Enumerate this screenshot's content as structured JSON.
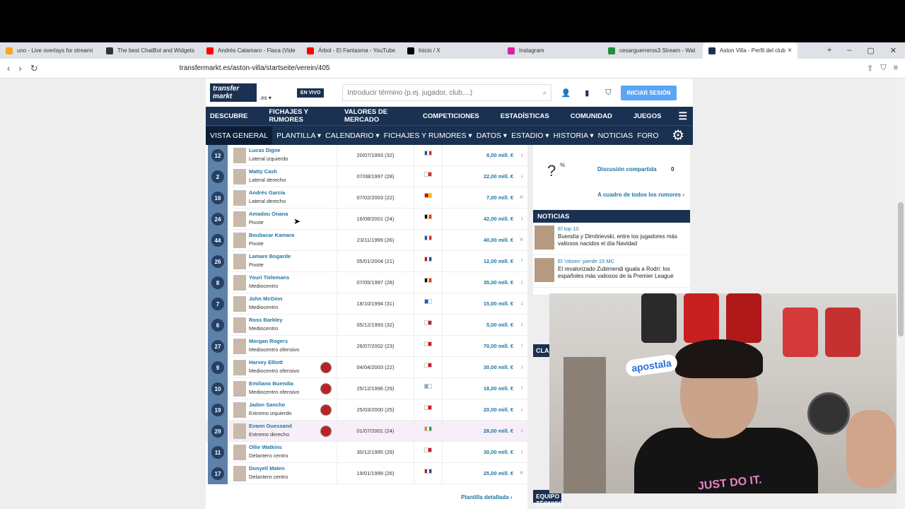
{
  "browser": {
    "tabs": [
      {
        "label": "uno - Live overlays for streami",
        "color": "#f5a623"
      },
      {
        "label": "The best ChatBot and Widgets",
        "color": "#333333"
      },
      {
        "label": "Andrés Calamaro - Flaca (Vide",
        "color": "#ff0000"
      },
      {
        "label": "Árbol - El Fantasma - YouTube",
        "color": "#ff0000"
      },
      {
        "label": "Inicio / X",
        "color": "#000000"
      },
      {
        "label": "Instagram",
        "color": "#d6249f"
      },
      {
        "label": "cesarguerreros3 Stream - Wat",
        "color": "#1f8f3a"
      },
      {
        "label": "Aston Villa - Perfil del club",
        "color": "#1a3151"
      }
    ],
    "url": "transfermarkt.es/aston-villa/startseite/verein/405"
  },
  "header": {
    "logo_line1": "transfer",
    "logo_line2": "markt",
    "tld": ".es ▾",
    "live": "EN VIVO",
    "search_placeholder": "Introducir término (p.ej. jugador, club,...)",
    "login": "INICIAR SESIÓN"
  },
  "main_nav": [
    "DESCUBRE",
    "FICHAJES Y RUMORES",
    "VALORES DE MERCADO",
    "COMPETICIONES",
    "ESTADÍSTICAS",
    "COMUNIDAD",
    "JUEGOS"
  ],
  "sub_nav": [
    "VISTA GENERAL",
    "PLANTILLA ▾",
    "CALENDARIO ▾",
    "FICHAJES Y RUMORES ▾",
    "DATOS ▾",
    "ESTADIO ▾",
    "HISTORIA ▾",
    "NOTICIAS",
    "FORO"
  ],
  "squad": [
    {
      "num": "12",
      "name": "Lucas Digne",
      "pos": "Lateral izquierdo",
      "dob": "20/07/1993 (32)",
      "value": "8,00 mill. €",
      "trend": "down"
    },
    {
      "num": "2",
      "name": "Matty Cash",
      "pos": "Lateral derecho",
      "dob": "07/08/1997 (28)",
      "value": "22,00 mill. €",
      "trend": "down"
    },
    {
      "num": "16",
      "name": "Andrés García",
      "pos": "Lateral derecho",
      "dob": "07/02/2003 (22)",
      "value": "7,00 mill. €",
      "trend": "flat"
    },
    {
      "num": "24",
      "name": "Amadou Onana",
      "pos": "Pivote",
      "dob": "16/08/2001 (24)",
      "value": "42,00 mill. €",
      "trend": "down"
    },
    {
      "num": "44",
      "name": "Boubacar Kamara",
      "pos": "Pivote",
      "dob": "23/11/1999 (26)",
      "value": "40,00 mill. €",
      "trend": "flat"
    },
    {
      "num": "26",
      "name": "Lamare Bogarde",
      "pos": "Pivote",
      "dob": "05/01/2004 (21)",
      "value": "12,00 mill. €",
      "trend": "up"
    },
    {
      "num": "8",
      "name": "Youri Tielemans",
      "pos": "Mediocentro",
      "dob": "07/05/1997 (28)",
      "value": "35,00 mill. €",
      "trend": "down"
    },
    {
      "num": "7",
      "name": "John McGinn",
      "pos": "Mediocentro",
      "dob": "18/10/1994 (31)",
      "value": "15,00 mill. €",
      "trend": "down"
    },
    {
      "num": "6",
      "name": "Ross Barkley",
      "pos": "Mediocentro",
      "dob": "05/12/1993 (32)",
      "value": "5,00 mill. €",
      "trend": "down"
    },
    {
      "num": "27",
      "name": "Morgan Rogers",
      "pos": "Mediocentro ofensivo",
      "dob": "26/07/2002 (23)",
      "value": "70,00 mill. €",
      "trend": "up"
    },
    {
      "num": "9",
      "name": "Harvey Elliott",
      "pos": "Mediocentro ofensivo",
      "dob": "04/04/2003 (22)",
      "value": "30,00 mill. €",
      "trend": "down"
    },
    {
      "num": "10",
      "name": "Emiliano Buendía",
      "pos": "Mediocentro ofensivo",
      "dob": "25/12/1996 (29)",
      "value": "18,00 mill. €",
      "trend": "up"
    },
    {
      "num": "19",
      "name": "Jadon Sancho",
      "pos": "Extremo izquierdo",
      "dob": "25/03/2000 (25)",
      "value": "20,00 mill. €",
      "trend": "down"
    },
    {
      "num": "29",
      "name": "Evann Guessand",
      "pos": "Extremo derecho",
      "dob": "01/07/2001 (24)",
      "value": "28,00 mill. €",
      "trend": "down"
    },
    {
      "num": "11",
      "name": "Ollie Watkins",
      "pos": "Delantero centro",
      "dob": "30/12/1995 (29)",
      "value": "30,00 mill. €",
      "trend": "down"
    },
    {
      "num": "17",
      "name": "Donyell Malen",
      "pos": "Delantero centro",
      "dob": "19/01/1999 (26)",
      "value": "25,00 mill. €",
      "trend": "flat"
    }
  ],
  "squad_link": "Plantilla detallada",
  "rumors": {
    "question": "?",
    "pct": "%",
    "discussion": "Discusión compartida",
    "count": "0",
    "link": "A cuadro de todos los rumores"
  },
  "news": {
    "title": "NOTICIAS",
    "items": [
      {
        "tag": "El top 10",
        "text": "Buendía y Dimitrievski, entre los jugadores más valiosos nacidos el día Navidad"
      },
      {
        "tag": "El 'citizen' pierde 15 MC",
        "text": "El revalorizado Zubimendi iguala a Rodri: los españoles más valiosos de la Premier League"
      }
    ]
  },
  "standings_title": "CLAS",
  "staff_title": "EQUIPO TÉCNICO",
  "webcam": {
    "sticker": "apostala",
    "shirt_text": "JUST DO IT."
  }
}
